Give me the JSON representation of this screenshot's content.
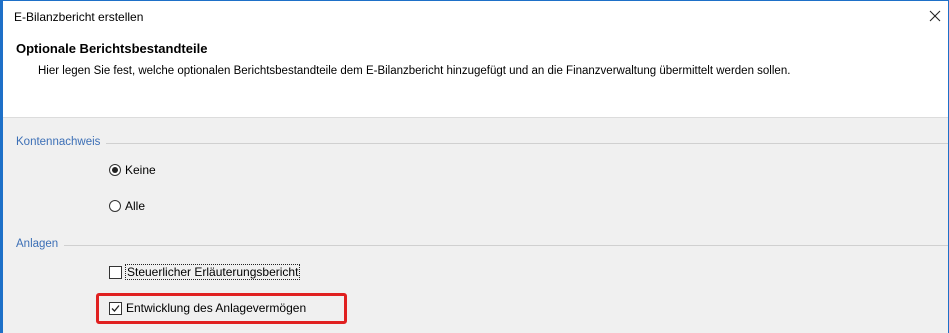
{
  "window": {
    "title": "E-Bilanzbericht erstellen",
    "close_glyph": "close-icon"
  },
  "header": {
    "title": "Optionale Berichtsbestandteile",
    "description": "Hier legen Sie fest, welche optionalen Berichtsbestandteile dem E-Bilanzbericht hinzugefügt und an die Finanzverwaltung übermittelt werden sollen."
  },
  "groups": {
    "kontennachweis": {
      "label": "Kontennachweis",
      "options": [
        {
          "label": "Keine",
          "checked": true
        },
        {
          "label": "Alle",
          "checked": false
        }
      ]
    },
    "anlagen": {
      "label": "Anlagen",
      "options": [
        {
          "label": "Steuerlicher Erläuterungsbericht",
          "checked": false
        },
        {
          "label": "Entwicklung des Anlagevermögen",
          "checked": true
        }
      ]
    }
  },
  "colors": {
    "accent_border": "#1e70c8",
    "group_label": "#3c6fb6",
    "highlight": "#e02020",
    "body_bg": "#f0f0f0"
  }
}
